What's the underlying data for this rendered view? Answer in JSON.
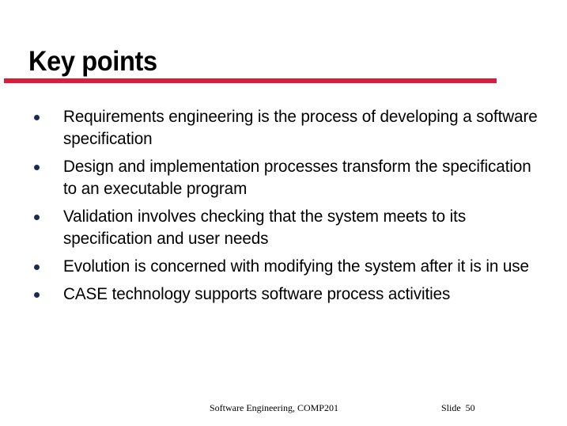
{
  "slide": {
    "title": "Key points",
    "accent_color": "#dd1b3c",
    "bullet_color": "#1b2a55",
    "background_color": "#ffffff",
    "text_color": "#000000"
  },
  "bullets": [
    {
      "text": "Requirements engineering is the process of developing a software specification"
    },
    {
      "text": "Design and implementation processes transform the specification to an executable program"
    },
    {
      "text": "Validation involves checking that the system meets to its specification and user needs"
    },
    {
      "text": "Evolution is concerned with modifying the system after it is in use"
    },
    {
      "text": "CASE technology supports software process activities"
    }
  ],
  "footer": {
    "course": "Software Engineering, COMP201",
    "slide_number": "Slide  50"
  }
}
